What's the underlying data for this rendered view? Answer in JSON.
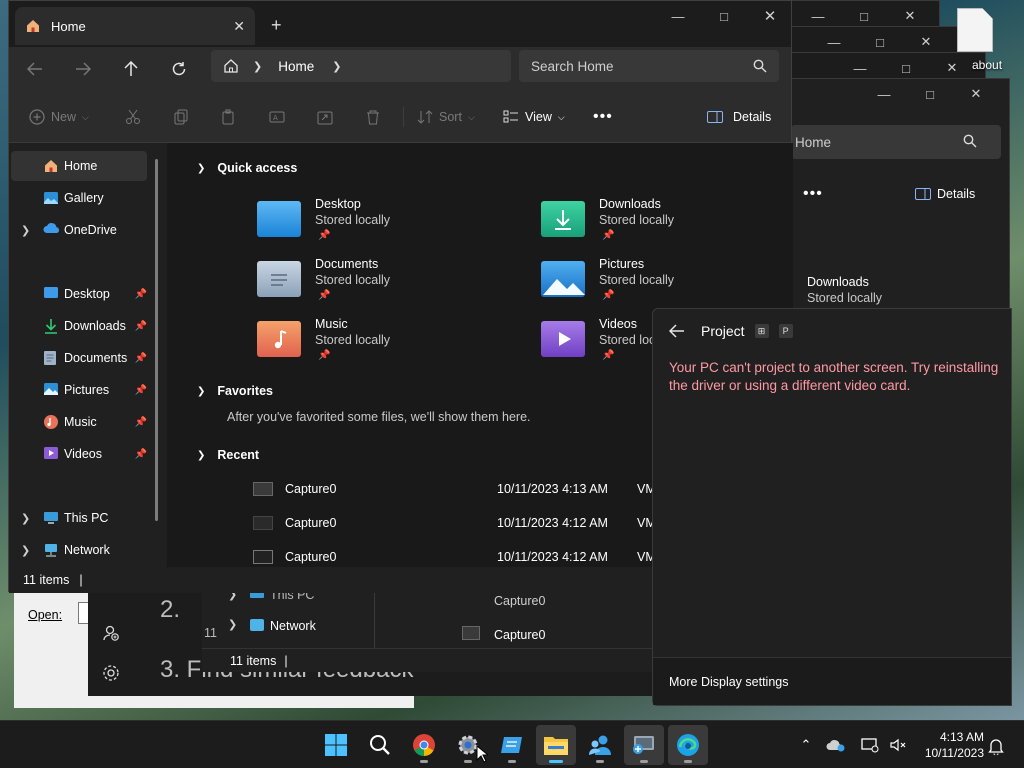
{
  "desktop": {
    "file_label": "about"
  },
  "explorer": {
    "tab_title": "Home",
    "address": {
      "crumb": "Home"
    },
    "search_placeholder": "Search Home",
    "commands": {
      "new": "New",
      "sort": "Sort",
      "view": "View",
      "details": "Details"
    },
    "sidebar": {
      "items": [
        {
          "label": "Home"
        },
        {
          "label": "Gallery"
        },
        {
          "label": "OneDrive"
        },
        {
          "label": "Desktop"
        },
        {
          "label": "Downloads"
        },
        {
          "label": "Documents"
        },
        {
          "label": "Pictures"
        },
        {
          "label": "Music"
        },
        {
          "label": "Videos"
        },
        {
          "label": "This PC"
        },
        {
          "label": "Network"
        }
      ]
    },
    "sections": {
      "quick_access": "Quick access",
      "favorites": "Favorites",
      "recent": "Recent"
    },
    "quick_access": [
      {
        "name": "Desktop",
        "status": "Stored locally"
      },
      {
        "name": "Downloads",
        "status": "Stored locally"
      },
      {
        "name": "Documents",
        "status": "Stored locally"
      },
      {
        "name": "Pictures",
        "status": "Stored locally"
      },
      {
        "name": "Music",
        "status": "Stored locally"
      },
      {
        "name": "Videos",
        "status": "Stored locally"
      }
    ],
    "favorites_empty": "After you've favorited some files, we'll show them here.",
    "recent": [
      {
        "name": "Capture0",
        "date": "10/11/2023 4:13 AM",
        "loc": "VM"
      },
      {
        "name": "Capture0",
        "date": "10/11/2023 4:12 AM",
        "loc": "VM"
      },
      {
        "name": "Capture0",
        "date": "10/11/2023 4:12 AM",
        "loc": "VM"
      }
    ],
    "status": "11 items"
  },
  "background_explorer": {
    "search_fragment": "Home",
    "details": "Details",
    "downloads_name": "Downloads",
    "downloads_status": "Stored locally",
    "this_pc": "This PC",
    "network": "Network",
    "capture_a": "Capture0",
    "capture_b": "Capture0",
    "status": "11 items",
    "status_fragment": "11"
  },
  "feedback": {
    "step2": "2.",
    "step3": "3. Find similar feedback"
  },
  "run_dialog": {
    "open_label": "Open:"
  },
  "project": {
    "title": "Project",
    "shortcut_key": "P",
    "error": "Your PC can't project to another screen. Try reinstalling the driver or using a different video card.",
    "footer_link": "More Display settings"
  },
  "taskbar": {
    "time": "4:13 AM",
    "date": "10/11/2023"
  }
}
